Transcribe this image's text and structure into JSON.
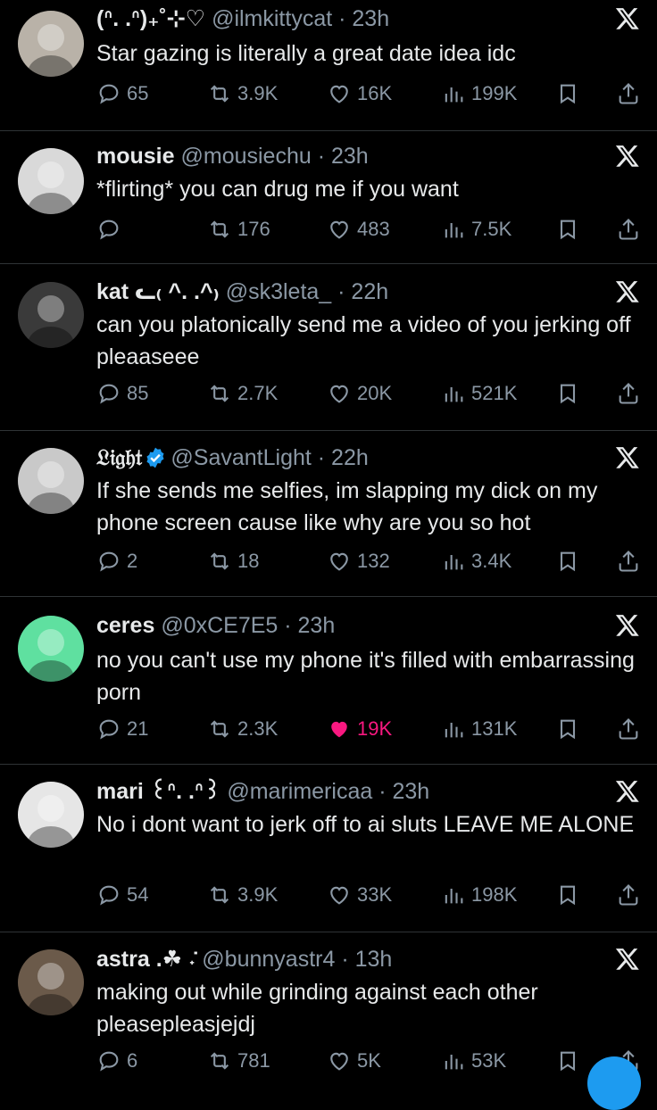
{
  "posts": [
    {
      "name": "(ᐢ. .ᐢ)₊˚⊹♡",
      "handle": "@ilmkittycat",
      "time": "23h",
      "verified": false,
      "text": "Star gazing is literally a great date idea idc",
      "replies": "65",
      "reposts": "3.9K",
      "likes": "16K",
      "views": "199K",
      "liked": false,
      "avatar_color": "#b9b2a8"
    },
    {
      "name": "mousie",
      "handle": "@mousiechu",
      "time": "23h",
      "verified": false,
      "text": "*flirting* you can drug me if you want",
      "replies": "",
      "reposts": "176",
      "likes": "483",
      "views": "7.5K",
      "liked": false,
      "avatar_color": "#d9d9d9"
    },
    {
      "name": "kat ᓚ₍ ^. .^₎",
      "handle": "@sk3leta_",
      "time": "22h",
      "verified": false,
      "text": "can you platonically send me a video of you jerking off pleaaseee",
      "replies": "85",
      "reposts": "2.7K",
      "likes": "20K",
      "views": "521K",
      "liked": false,
      "avatar_color": "#3a3a3a"
    },
    {
      "name": "𝔏𝔦𝔤𝔥𝔱",
      "handle": "@SavantLight",
      "time": "22h",
      "verified": true,
      "text": "If she sends me selfies, im slapping my dick on my phone screen cause like why are you so hot",
      "replies": "2",
      "reposts": "18",
      "likes": "132",
      "views": "3.4K",
      "liked": false,
      "avatar_color": "#c9c9c9"
    },
    {
      "name": "ceres",
      "handle": "@0xCE7E5",
      "time": "23h",
      "verified": false,
      "text": "no you can't use my phone it's filled with embarrassing porn",
      "replies": "21",
      "reposts": "2.3K",
      "likes": "19K",
      "views": "131K",
      "liked": true,
      "avatar_color": "#5fe0a0"
    },
    {
      "name": "mari ꒰ᐢ. .ᐢ꒱",
      "handle": "@marimericaa",
      "time": "23h",
      "verified": false,
      "text": "No i dont want to jerk off to ai sluts LEAVE ME ALONE",
      "replies": "54",
      "reposts": "3.9K",
      "likes": "33K",
      "views": "198K",
      "liked": false,
      "avatar_color": "#e6e6e6"
    },
    {
      "name": "astra .☘︎ ݁˖",
      "handle": "@bunnyastr4",
      "time": "13h",
      "verified": false,
      "text": "making out while grinding against each other pleasepleasjejdj",
      "replies": "6",
      "reposts": "781",
      "likes": "5K",
      "views": "53K",
      "liked": false,
      "avatar_color": "#6b5a4a"
    }
  ],
  "colors": {
    "background": "#000000",
    "text": "#e7e9ea",
    "muted": "#8b98a5",
    "divider": "#2f3336",
    "like": "#f91880",
    "verified": "#1d9bf0"
  }
}
